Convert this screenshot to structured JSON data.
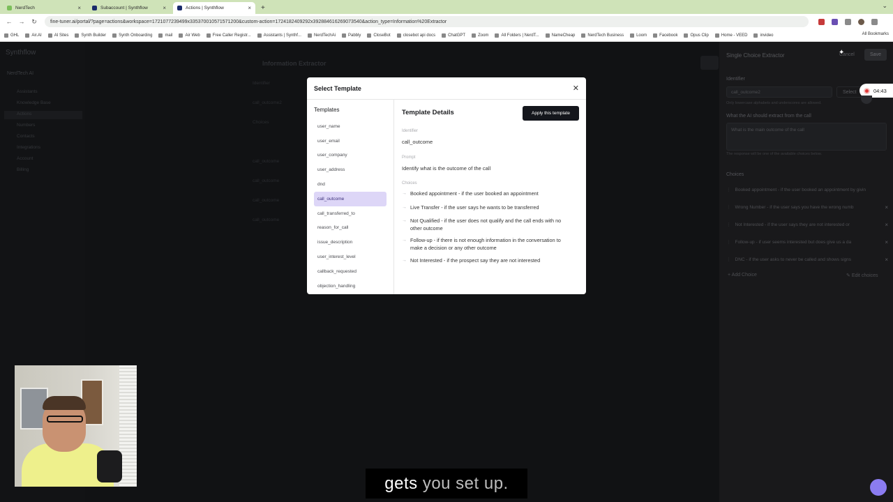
{
  "browser": {
    "tabs": [
      {
        "title": "NerdTech",
        "active": false
      },
      {
        "title": "Subaccount | Synthflow",
        "active": false
      },
      {
        "title": "Actions | Synthflow",
        "active": true
      }
    ],
    "new_tab": "+",
    "url": "fine-tuner.ai/portal/?page=actions&workspace=1721077239499x335370010571571200&custom-action=1724182409292x392884616269073540&action_type=Information%20Extractor",
    "bookmarks": [
      "GHL",
      "Air.AI",
      "AI Sites",
      "Synth Builder",
      "Synth Onboarding",
      "mail",
      "Air Web",
      "Free Caller Registr...",
      "Assistants | Synthf...",
      "NerdTechAi",
      "Pabbly",
      "CloseBot",
      "closebot api docs",
      "ChatGPT",
      "Zoom",
      "All Folders | NerdT...",
      "NameCheap",
      "NerdTech Business",
      "Loom",
      "Facebook",
      "Opus Clip",
      "Home - VEED",
      "invideo"
    ],
    "all_bookmarks": "All Bookmarks"
  },
  "background": {
    "logo": "Synthflow",
    "workspace": "NerdTech AI",
    "sidebar_items": [
      "Assistants",
      "Knowledge Base",
      "Actions",
      "Numbers",
      "Contacts",
      "Integrations",
      "Account",
      "Billing"
    ],
    "page_title": "Information Extractor",
    "list_items": [
      "Identifier",
      "call_outcome2",
      "Choices",
      "",
      "call_outcome",
      "call_outcome",
      "call_outcome",
      "call_outcome"
    ]
  },
  "right_panel": {
    "title": "Single Choice Extractor",
    "cancel_label": "Cancel",
    "save_label": "Save",
    "identifier_label": "Identifier",
    "identifier_value": "call_outcome2",
    "identifier_hint": "Only lowercase alphabets and underscores are allowed.",
    "select_label": "Select",
    "question_label": "What the AI should extract from the call",
    "question_value": "What is the main outcome of the call",
    "question_hint": "The response will be one of the available choices below.",
    "choices_label": "Choices",
    "choices": [
      "Booked appointment - if the user booked an appointment by givin",
      "Wrong Number - if the user says you have the wrong numb",
      "Not Interested - if the user says they are not interested or",
      "Follow-up - if user seems interested but does give us a da",
      "DNC - if the user asks to never be called and shows signs"
    ],
    "add_choice_label": "Add Choice",
    "edit_choices_label": "Edit choices"
  },
  "recording": {
    "time": "04:43"
  },
  "modal": {
    "title": "Select Template",
    "close_icon": "close-icon",
    "templates_heading": "Templates",
    "templates": [
      "user_name",
      "user_email",
      "user_company",
      "user_address",
      "dnd",
      "call_outcome",
      "call_transferred_to",
      "reason_for_call",
      "issue_description",
      "user_interest_level",
      "callback_requested",
      "objection_handling"
    ],
    "selected_template": "call_outcome",
    "details_title": "Template Details",
    "apply_label": "Apply this template",
    "identifier_label": "Identifier",
    "identifier_value": "call_outcome",
    "prompt_label": "Prompt",
    "prompt_value": "Identify what is the outcome of the call",
    "choices_label": "Choices",
    "choices": [
      "Booked appointment - if the user booked an appointment",
      "Live Transfer - if the user says he wants to be transferred",
      "Not Qualified - if the user does not qualify and the call ends with no other outcome",
      "Follow-up - if there is not enough information in the conversation to make a decision or any other outcome",
      "Not Interested - if the prospect say they are not interested"
    ]
  },
  "caption": {
    "bright": "gets",
    "dim": "you set up."
  }
}
